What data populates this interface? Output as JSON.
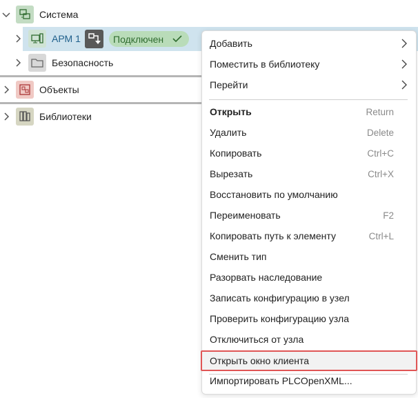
{
  "tree": {
    "system_label": "Система",
    "arm_label": "АРМ 1",
    "status_label": "Подключен",
    "security_label": "Безопасность",
    "objects_label": "Объекты",
    "libraries_label": "Библиотеки"
  },
  "colors": {
    "selected_row": "#cfe3ee",
    "status_badge": "#b9dcb9",
    "status_text": "#2f6b2f",
    "highlight_border": "#e05555"
  },
  "menu": {
    "add": "Добавить",
    "place_in_library": "Поместить в библиотеку",
    "go_to": "Перейти",
    "open": "Открыть",
    "open_sc": "Return",
    "delete": "Удалить",
    "delete_sc": "Delete",
    "copy": "Копировать",
    "copy_sc": "Ctrl+C",
    "cut": "Вырезать",
    "cut_sc": "Ctrl+X",
    "restore_default": "Восстановить по умолчанию",
    "rename": "Переименовать",
    "rename_sc": "F2",
    "copy_path": "Копировать путь к элементу",
    "copy_path_sc": "Ctrl+L",
    "change_type": "Сменить тип",
    "break_inheritance": "Разорвать наследование",
    "write_config": "Записать конфигурацию в узел",
    "check_config": "Проверить конфигурацию узла",
    "disconnect": "Отключиться от узла",
    "open_client": "Открыть окно клиента",
    "import_plc": "Импортировать PLCOpenXML..."
  }
}
